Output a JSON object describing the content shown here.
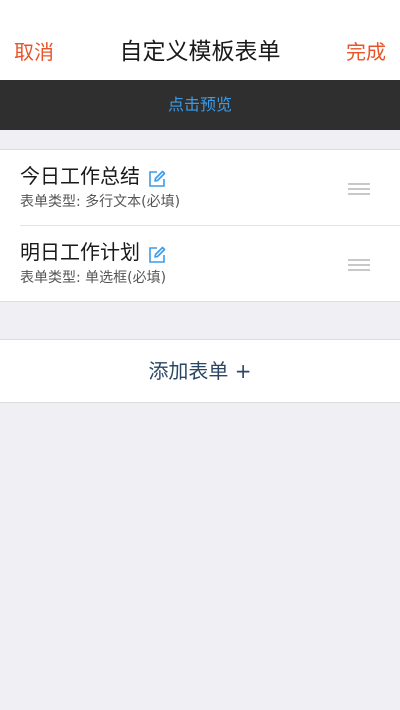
{
  "navbar": {
    "cancel_label": "取消",
    "title": "自定义模板表单",
    "done_label": "完成"
  },
  "preview": {
    "label": "点击预览"
  },
  "forms": [
    {
      "title": "今日工作总结",
      "subtitle": "表单类型: 多行文本(必填)"
    },
    {
      "title": "明日工作计划",
      "subtitle": "表单类型: 单选框(必填)"
    }
  ],
  "add_form": {
    "label": "添加表单 +"
  },
  "colors": {
    "accent": "#e8542a",
    "link_blue": "#3b9be8",
    "preview_bg": "#2f2f2f",
    "page_bg": "#efeff4",
    "add_text": "#2c4766"
  },
  "icons": [
    "edit-icon",
    "drag-handle-icon"
  ]
}
